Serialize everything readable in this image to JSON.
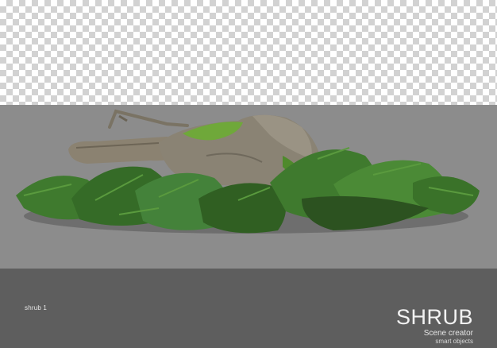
{
  "caption": "shrub 1",
  "brand": {
    "title": "SHRUB",
    "subtitle": "Scene creator",
    "tagline": "smart objects"
  },
  "colors": {
    "checker_light": "#ffffff",
    "checker_dark": "#d2d2d2",
    "stage": "#8c8c8c",
    "footer": "#5e5e5e",
    "fern": "#3f7a2e",
    "moss": "#6fa83a",
    "rock": "#8a8374"
  },
  "icons": [
    "transparency-checkerboard",
    "shrub-rock-log-photo"
  ]
}
